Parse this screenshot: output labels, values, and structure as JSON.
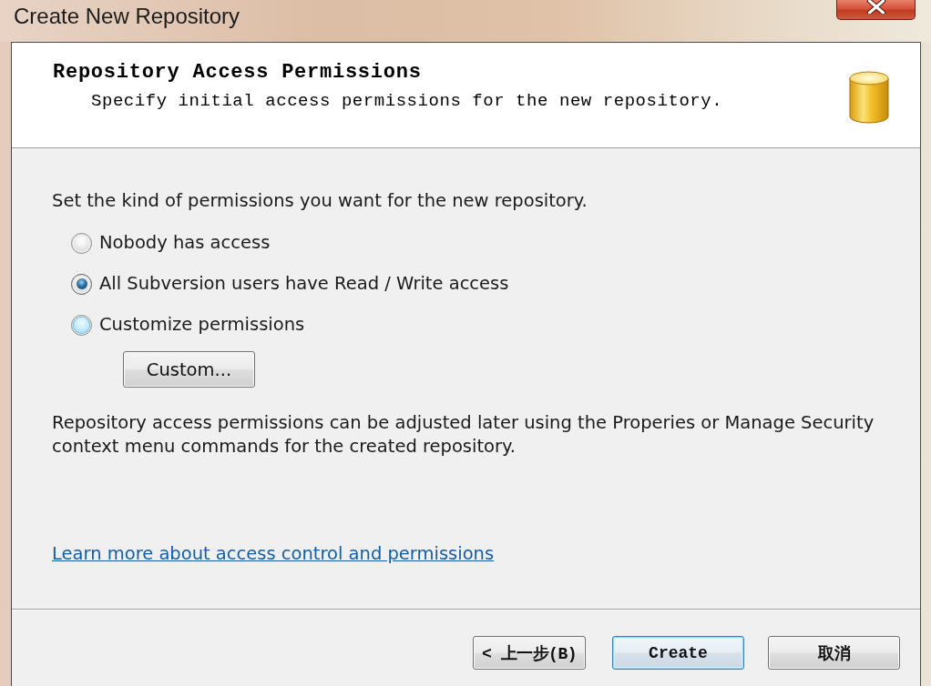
{
  "window": {
    "title": "Create New Repository"
  },
  "header": {
    "title": "Repository Access Permissions",
    "subtitle": "Specify initial access permissions for the new repository."
  },
  "body": {
    "prompt": "Set the kind of permissions you want for the new repository.",
    "permission_options": [
      {
        "label": "Nobody has access",
        "selected": false,
        "hovered": false
      },
      {
        "label": "All Subversion users have Read / Write access",
        "selected": true,
        "hovered": false
      },
      {
        "label": "Customize permissions",
        "selected": false,
        "hovered": true
      }
    ],
    "custom_button": "Custom...",
    "note": "Repository access permissions can be adjusted later using the Properies or Manage Security context menu commands for the created repository.",
    "help_link": "Learn more about access control and permissions"
  },
  "buttons": [
    {
      "label": "< 上一步(B)",
      "default": false
    },
    {
      "label": "Create",
      "default": true
    },
    {
      "label": "取消",
      "default": false
    }
  ]
}
